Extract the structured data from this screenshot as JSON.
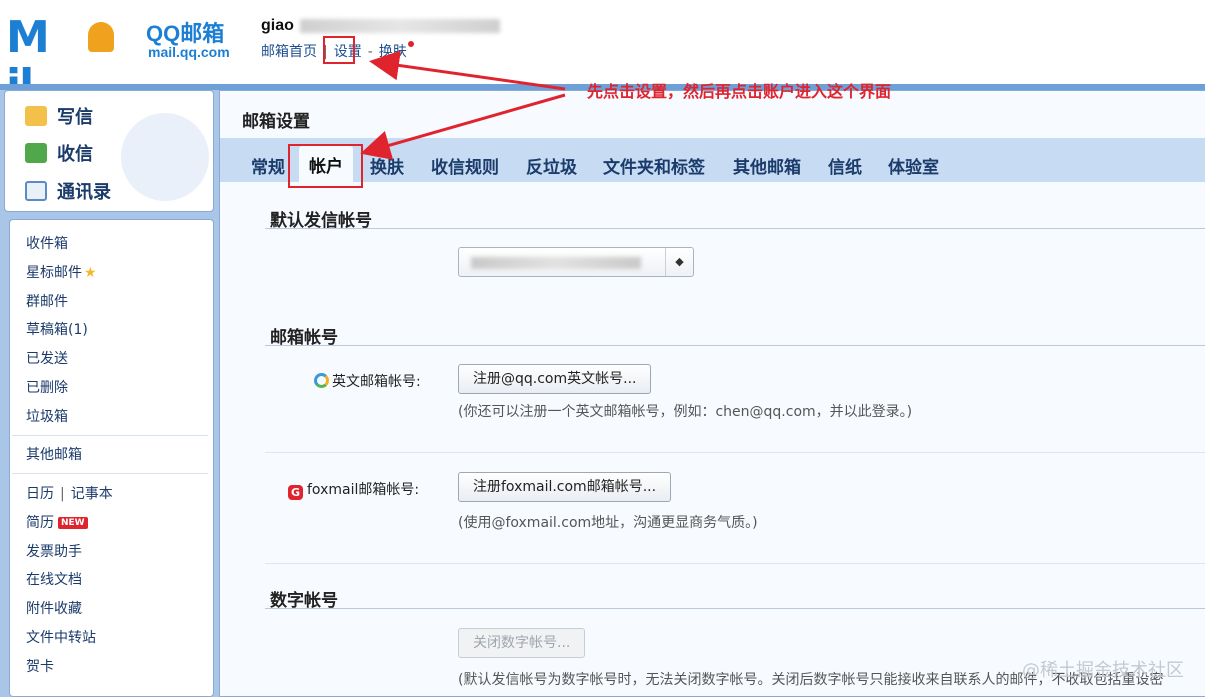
{
  "header": {
    "logo_text": "M il",
    "brand_name": "QQ邮箱",
    "brand_url": "mail.qq.com",
    "username": "giao",
    "links": [
      "邮箱首页",
      "设置",
      "换肤"
    ]
  },
  "annotation": "先点击设置，然后再点击账户进入这个界面",
  "sidebar": {
    "compose": "写信",
    "inbox": "收信",
    "contacts": "通讯录",
    "folders": [
      "收件箱",
      "星标邮件",
      "群邮件",
      "草稿箱(1)",
      "已发送",
      "已删除",
      "垃圾箱"
    ],
    "other_mail": "其他邮箱",
    "calendar": "日历",
    "notes": "记事本",
    "resume": "简历",
    "new_badge": "NEW",
    "tools": [
      "发票助手",
      "在线文档",
      "附件收藏",
      "文件中转站",
      "贺卡"
    ]
  },
  "main": {
    "title": "邮箱设置",
    "tabs": [
      "常规",
      "帐户",
      "换肤",
      "收信规则",
      "反垃圾",
      "文件夹和标签",
      "其他邮箱",
      "信纸",
      "体验室"
    ],
    "active_tab": "帐户",
    "section_default_sender": "默认发信帐号",
    "section_accounts": "邮箱帐号",
    "english_label": "英文邮箱帐号:",
    "english_button": "注册@qq.com英文帐号...",
    "english_hint": "(你还可以注册一个英文邮箱帐号，例如：chen@qq.com，并以此登录。)",
    "foxmail_label": "foxmail邮箱帐号:",
    "foxmail_button": "注册foxmail.com邮箱帐号...",
    "foxmail_hint": "(使用@foxmail.com地址，沟通更显商务气质。)",
    "section_numeric": "数字帐号",
    "numeric_button": "关闭数字帐号...",
    "numeric_hint": "(默认发信帐号为数字帐号时，无法关闭数字帐号。关闭后数字帐号只能接收来自联系人的邮件，不收取包括重设密"
  },
  "watermark": "@稀土掘金技术社区",
  "colors": {
    "accent_blue": "#1d7fd4",
    "frame_blue": "#a9c6e8",
    "tab_bar": "#c7dcf3",
    "annotation_red": "#e0242e"
  },
  "icons": [
    "edit-icon",
    "inbox-icon",
    "contacts-icon",
    "star-icon",
    "english-account-icon",
    "foxmail-icon",
    "select-arrow-icon"
  ]
}
